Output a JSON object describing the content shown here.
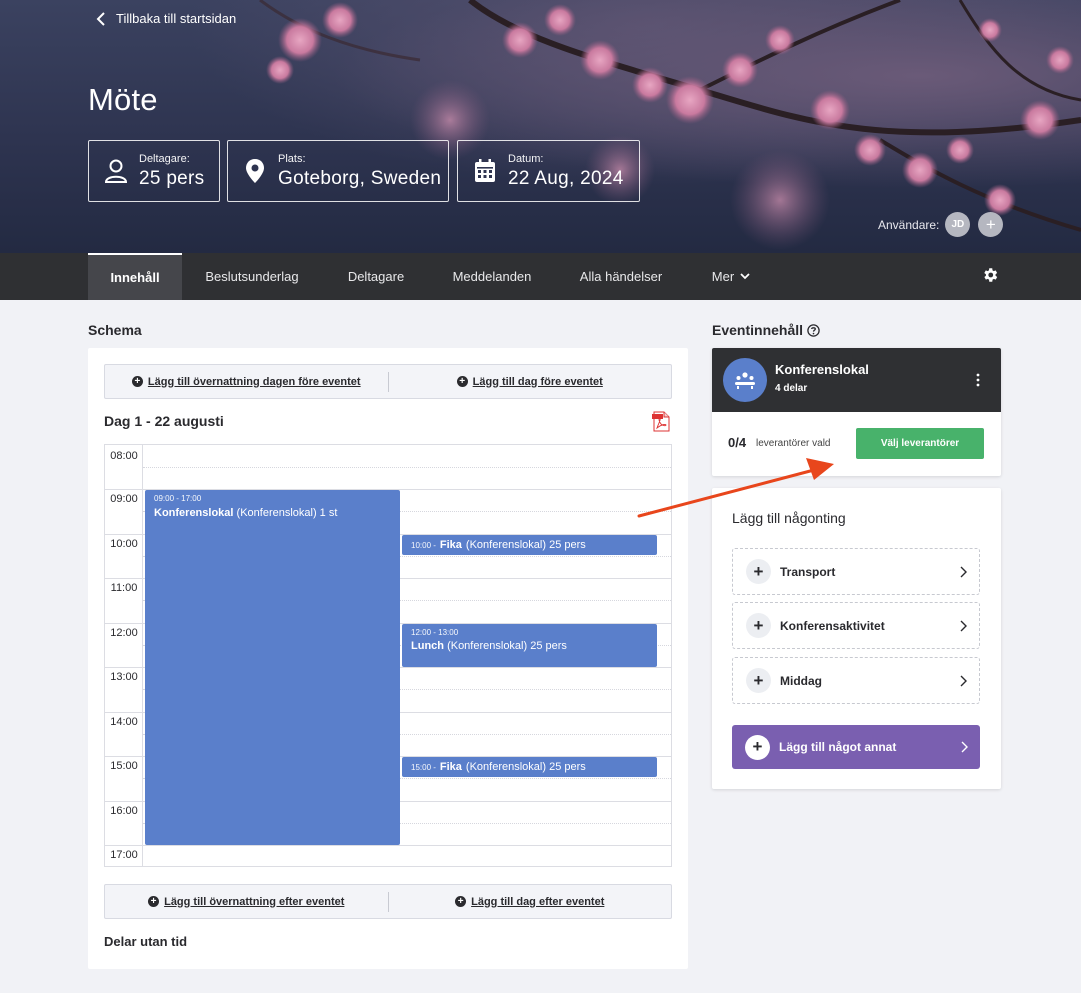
{
  "hero": {
    "back_label": "Tillbaka till startsidan",
    "title": "Möte",
    "participants": {
      "label": "Deltagare:",
      "value": "25 pers"
    },
    "location": {
      "label": "Plats:",
      "value": "Goteborg, Sweden"
    },
    "date": {
      "label": "Datum:",
      "value": "22 Aug, 2024"
    },
    "users_label": "Användare:",
    "user_initials": "JD",
    "add_user": "+"
  },
  "nav": {
    "tabs": [
      "Innehåll",
      "Beslutsunderlag",
      "Deltagare",
      "Meddelanden",
      "Alla händelser",
      "Mer"
    ],
    "active": "Innehåll"
  },
  "schema": {
    "title": "Schema",
    "add_night_before": "Lägg till övernattning dagen före eventet",
    "add_day_before": "Lägg till dag före eventet",
    "day_title": "Dag 1 - 22 augusti",
    "hours": [
      "08:00",
      "09:00",
      "10:00",
      "11:00",
      "12:00",
      "13:00",
      "14:00",
      "15:00",
      "16:00",
      "17:00"
    ],
    "events": [
      {
        "time": "09:00 - 17:00",
        "name": "Konferenslokal",
        "detail": "(Konferenslokal) 1 st"
      },
      {
        "time": "10:00 -",
        "name": "Fika",
        "detail": "(Konferenslokal) 25 pers"
      },
      {
        "time": "12:00 - 13:00",
        "name": "Lunch",
        "detail": "(Konferenslokal) 25 pers"
      },
      {
        "time": "15:00 -",
        "name": "Fika",
        "detail": "(Konferenslokal) 25 pers"
      }
    ],
    "add_night_after": "Lägg till övernattning efter eventet",
    "add_day_after": "Lägg till dag efter eventet",
    "untimed_title": "Delar utan tid"
  },
  "event_content": {
    "title": "Eventinnehåll",
    "card": {
      "name": "Konferenslokal",
      "parts": "4 delar",
      "count": "0/4",
      "count_label": "leverantörer vald",
      "button": "Välj leverantörer"
    }
  },
  "add_something": {
    "title": "Lägg till någonting",
    "options": [
      "Transport",
      "Konferensaktivitet",
      "Middag"
    ],
    "other": "Lägg till något annat"
  },
  "colors": {
    "nav_bg": "#2f3033",
    "event_blue": "#5a7fcb",
    "green": "#48b26b",
    "purple": "#7a5fb0",
    "arrow": "#e8461c"
  }
}
